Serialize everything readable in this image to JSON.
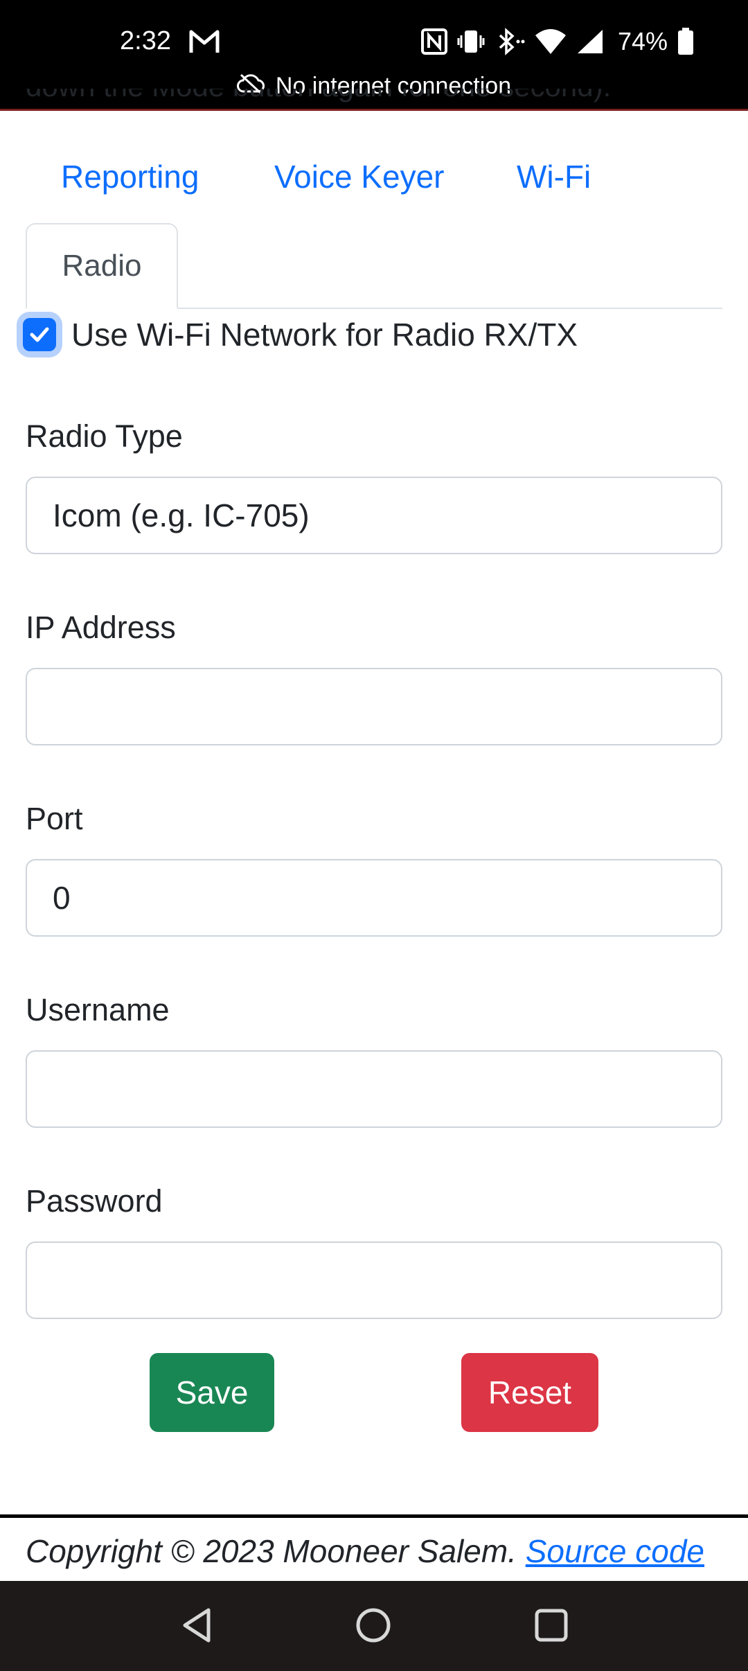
{
  "status_bar": {
    "time": "2:32",
    "battery": "74%",
    "notice": "No internet connection"
  },
  "page": {
    "cut_text": "down the Mode button again for one second).",
    "nav_links": [
      "Reporting",
      "Voice Keyer",
      "Wi-Fi"
    ],
    "active_tab": "Radio",
    "checkbox": {
      "label": "Use Wi-Fi Network for Radio RX/TX",
      "checked": true
    },
    "fields": {
      "radio_type": {
        "label": "Radio Type",
        "value": "Icom (e.g. IC-705)"
      },
      "ip_address": {
        "label": "IP Address",
        "value": ""
      },
      "port": {
        "label": "Port",
        "value": "0"
      },
      "username": {
        "label": "Username",
        "value": ""
      },
      "password": {
        "label": "Password",
        "value": ""
      }
    },
    "buttons": {
      "save": "Save",
      "reset": "Reset"
    },
    "footer": {
      "copyright": "Copyright © 2023 Mooneer Salem.",
      "link": "Source code"
    }
  },
  "colors": {
    "link": "#0d6efd",
    "save": "#198754",
    "reset": "#dc3545",
    "status_bar": "#000000",
    "nav_bar": "#1e1a1a"
  },
  "icons": [
    "gmail-icon",
    "nfc-icon",
    "vibrate-icon",
    "bluetooth-icon",
    "wifi-icon",
    "signal-icon",
    "battery-icon",
    "cloud-off-icon",
    "back-icon",
    "home-icon",
    "recents-icon",
    "check-icon"
  ]
}
